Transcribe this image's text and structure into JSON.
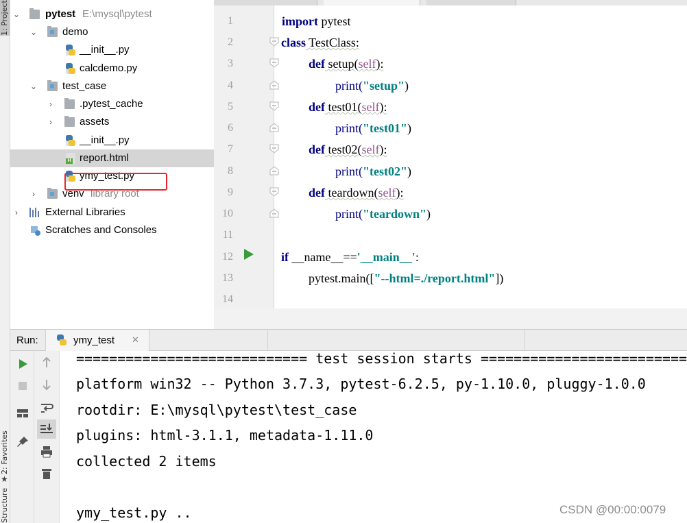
{
  "side_tabs": {
    "project": "1: Project",
    "favorites": "2: Favorites",
    "structure": "Structure"
  },
  "project_tree": {
    "root_name": "pytest",
    "root_path": "E:\\mysql\\pytest",
    "demo": "demo",
    "demo_init": "__init__.py",
    "calcdemo": "calcdemo.py",
    "test_case": "test_case",
    "pytest_cache": ".pytest_cache",
    "assets": "assets",
    "tc_init": "__init__.py",
    "report": "report.html",
    "ymy_test": "ymy_test.py",
    "venv": "venv",
    "venv_hint": "library root",
    "external_libraries": "External Libraries",
    "scratches": "Scratches and Consoles"
  },
  "editor": {
    "line_numbers": [
      "1",
      "2",
      "3",
      "4",
      "5",
      "6",
      "7",
      "8",
      "9",
      "10",
      "11",
      "12",
      "13",
      "14"
    ],
    "code": {
      "l1_kw": "import",
      "l1_rest": " pytest",
      "l2_kw": "class",
      "l2_rest": " TestClass:",
      "l3_kw": "def",
      "l3_name": " setup(",
      "l3_self": "self",
      "l3_end": "):",
      "l4_fn": "print(",
      "l4_str": "\"setup\"",
      "l4_end": ")",
      "l5_kw": "def",
      "l5_name": " test01(",
      "l5_self": "self",
      "l5_end": "):",
      "l6_fn": "print(",
      "l6_str": "\"test01\"",
      "l6_end": ")",
      "l7_kw": "def",
      "l7_name": " test02(",
      "l7_self": "self",
      "l7_end": "):",
      "l8_fn": "print(",
      "l8_str": "\"test02\"",
      "l8_end": ")",
      "l9_kw": "def",
      "l9_name": " teardown(",
      "l9_self": "self",
      "l9_end": "):",
      "l10_fn": "print(",
      "l10_str": "\"teardown\"",
      "l10_end": ")",
      "l12_kw": "if",
      "l12_mid": " __name__==",
      "l12_str": "'__main__'",
      "l12_end": ":",
      "l13_fn": "pytest.main([",
      "l13_str": "\"--html=./report.html\"",
      "l13_end": "])"
    }
  },
  "run_panel": {
    "label": "Run:",
    "tab_label": "ymy_test",
    "console_lines": [
      "============================ test session starts ============================",
      "platform win32 -- Python 3.7.3, pytest-6.2.5, py-1.10.0, pluggy-1.0.0",
      "rootdir: E:\\mysql\\pytest\\test_case",
      "plugins: html-3.1.1, metadata-1.11.0",
      "collected 2 items",
      "",
      "ymy_test.py .."
    ]
  },
  "watermark": "CSDN @00:00:0079",
  "colors": {
    "keyword": "#000080",
    "string": "#008080",
    "self": "#94558d",
    "highlight_box": "#e8262c",
    "run_green": "#3a9b3a"
  }
}
